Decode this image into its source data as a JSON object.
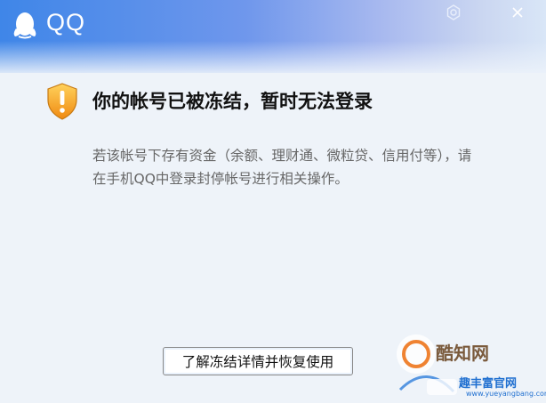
{
  "window": {
    "app_title": "QQ",
    "settings_icon": "gear-icon",
    "close_icon": "close-icon",
    "logo_icon": "qq-penguin-icon"
  },
  "dialog": {
    "warning_icon": "shield-warning-icon",
    "heading": "你的帐号已被冻结，暂时无法登录",
    "message": "若该帐号下存有资金（余额、理财通、微粒贷、信用付等），请在手机QQ中登录封停帐号进行相关操作。",
    "button_label": "了解冻结详情并恢复使用"
  },
  "watermark": {
    "brand": "酷知网",
    "site": "趣丰富官网",
    "url": "www.yueyangbang.com"
  },
  "colors": {
    "title_gradient_start": "#3f86e8",
    "title_gradient_end": "#d9e6f7",
    "background": "#eef3f9",
    "warning_orange": "#f5a623"
  }
}
